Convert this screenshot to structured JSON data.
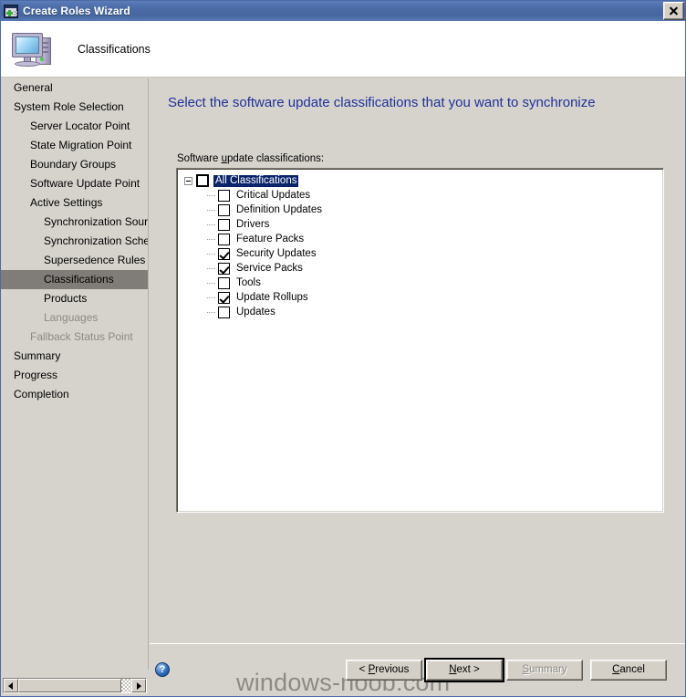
{
  "window": {
    "title": "Create Roles Wizard",
    "icon": "wizard-window-icon",
    "close_label": "✕"
  },
  "header": {
    "icon": "computer-icon",
    "title": "Classifications"
  },
  "sidebar": {
    "items": [
      {
        "label": "General",
        "level": 0,
        "state": "normal"
      },
      {
        "label": "System Role Selection",
        "level": 0,
        "state": "normal"
      },
      {
        "label": "Server Locator Point",
        "level": 1,
        "state": "normal"
      },
      {
        "label": "State Migration Point",
        "level": 1,
        "state": "normal"
      },
      {
        "label": "Boundary Groups",
        "level": 1,
        "state": "normal"
      },
      {
        "label": "Software Update Point",
        "level": 1,
        "state": "normal"
      },
      {
        "label": "Active Settings",
        "level": 1,
        "state": "normal"
      },
      {
        "label": "Synchronization Source",
        "level": 2,
        "state": "normal"
      },
      {
        "label": "Synchronization Schedule",
        "level": 2,
        "state": "normal"
      },
      {
        "label": "Supersedence Rules",
        "level": 2,
        "state": "normal"
      },
      {
        "label": "Classifications",
        "level": 2,
        "state": "selected"
      },
      {
        "label": "Products",
        "level": 2,
        "state": "normal"
      },
      {
        "label": "Languages",
        "level": 2,
        "state": "disabled"
      },
      {
        "label": "Fallback Status Point",
        "level": 1,
        "state": "disabled"
      },
      {
        "label": "Summary",
        "level": 0,
        "state": "normal"
      },
      {
        "label": "Progress",
        "level": 0,
        "state": "normal"
      },
      {
        "label": "Completion",
        "level": 0,
        "state": "normal"
      }
    ],
    "scrollbar": {
      "left_arrow": "scroll-left-icon",
      "right_arrow": "scroll-right-icon"
    }
  },
  "main": {
    "heading": "Select the software update classifications that you want to synchronize",
    "list_label_before": "Software ",
    "list_label_accel": "u",
    "list_label_after": "pdate classifications:",
    "tree": {
      "root": {
        "label": "All Classifications",
        "checked": false,
        "selected": true,
        "expanded": true
      },
      "children": [
        {
          "label": "Critical Updates",
          "checked": false
        },
        {
          "label": "Definition Updates",
          "checked": false
        },
        {
          "label": "Drivers",
          "checked": false
        },
        {
          "label": "Feature Packs",
          "checked": false
        },
        {
          "label": "Security Updates",
          "checked": true
        },
        {
          "label": "Service Packs",
          "checked": true
        },
        {
          "label": "Tools",
          "checked": false
        },
        {
          "label": "Update Rollups",
          "checked": true
        },
        {
          "label": "Updates",
          "checked": false
        }
      ]
    }
  },
  "footer": {
    "help_icon": "help-question-icon",
    "help_glyph": "?",
    "watermark": "windows-noob.com",
    "buttons": [
      {
        "id": "previous",
        "before": "< ",
        "accel": "P",
        "after": "revious",
        "state": "normal"
      },
      {
        "id": "next",
        "before": "",
        "accel": "N",
        "after": "ext >",
        "state": "default"
      },
      {
        "id": "summary",
        "before": "",
        "accel": "S",
        "after": "ummary",
        "state": "disabled"
      },
      {
        "id": "cancel",
        "before": "",
        "accel": "C",
        "after": "ancel",
        "state": "normal"
      }
    ]
  },
  "colors": {
    "titlebar": "#4a6ba5",
    "heading_text": "#20309a",
    "dialog_face": "#d6d3cc",
    "selection_sidebar": "#807d78",
    "selection_tree": "#0a246a"
  }
}
